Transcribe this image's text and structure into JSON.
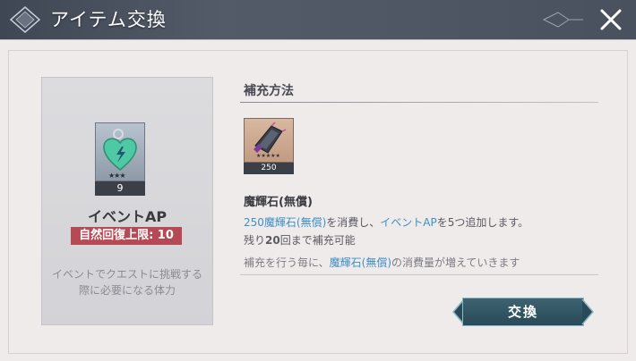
{
  "dialog": {
    "title": "アイテム交換",
    "close_icon": "close-icon"
  },
  "event_item": {
    "icon": "event-ap-heart-icon",
    "rarity": "★★★",
    "count": "9",
    "name": "イベントAP",
    "limit_text": "自然回復上限: 10",
    "description_line1": "イベントでクエストに挑戦する",
    "description_line2": "際に必要になる体力"
  },
  "refill": {
    "section_title": "補充方法",
    "material": {
      "icon": "magic-stone-icon",
      "rarity": "★★★★★",
      "count": "250"
    },
    "material_name": "魔輝石(無償)",
    "line1": {
      "cost": "250魔輝石(無償)",
      "mid": "を消費し、",
      "target": "イベントAP",
      "tail": "を5つ追加します。"
    },
    "line2": {
      "prefix": "残り",
      "count": "20",
      "suffix": "回まで補充可能"
    },
    "note": {
      "prefix": "補充を行う毎に、",
      "item": "魔輝石(無償)",
      "suffix": "の消費量が増えていきます"
    }
  },
  "actions": {
    "exchange_label": "交換"
  },
  "colors": {
    "accent_blue": "#3e8fc4",
    "limit_red": "#b54a55",
    "button_teal": "#294a58"
  }
}
